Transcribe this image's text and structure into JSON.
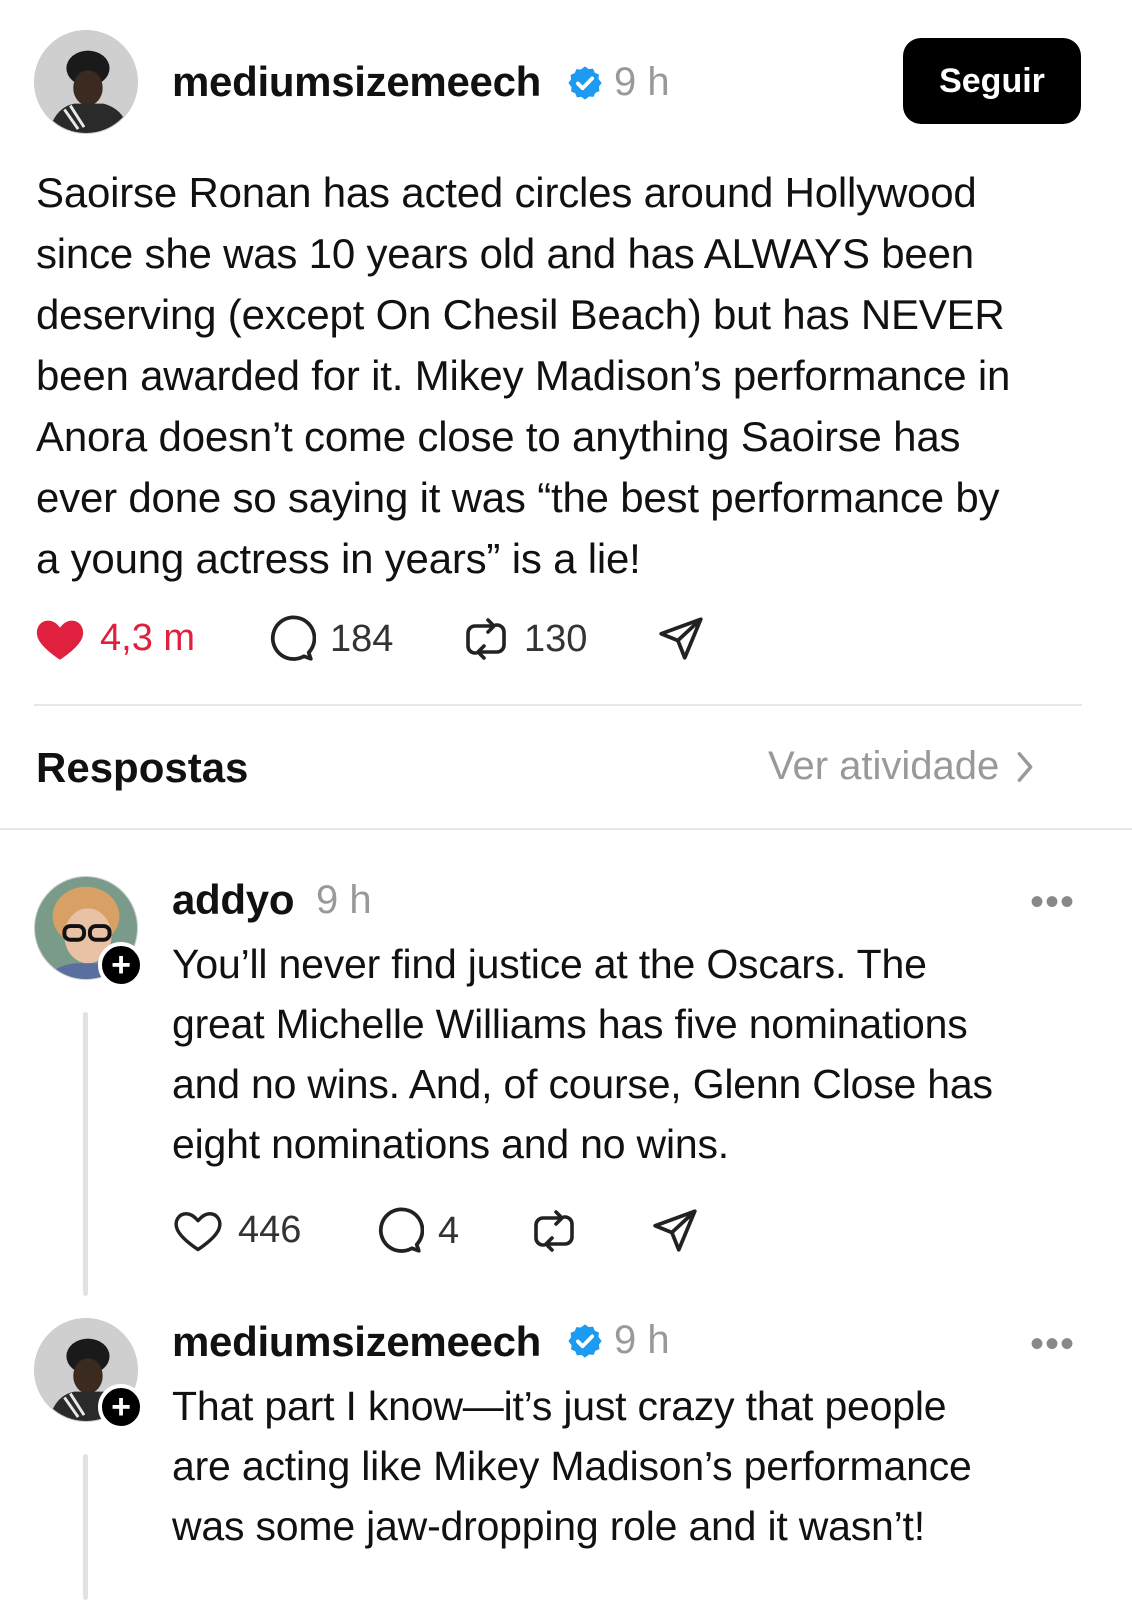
{
  "post": {
    "username": "mediumsizemeech",
    "time": "9 h",
    "follow_label": "Seguir",
    "text_lines": [
      "Saoirse Ronan has acted circles around Hollywood",
      "since she was 10 years old and has ALWAYS been",
      "deserving (except On Chesil Beach) but has NEVER",
      "been awarded for it. Mikey Madison’s performance in",
      "Anora doesn’t come close to anything Saoirse has",
      "ever done so saying it was “the best performance by",
      "a young actress in years” is a lie!"
    ],
    "likes": "4,3 m",
    "comments": "184",
    "reposts": "130"
  },
  "replies_header": {
    "title": "Respostas",
    "activity_label": "Ver atividade"
  },
  "reply1": {
    "username": "addyo",
    "time": "9 h",
    "more": "•••",
    "text_lines": [
      "You’ll never find justice at the Oscars. The",
      "great Michelle Williams has five nominations",
      "and no wins. And, of course, Glenn Close has",
      "eight nominations and no wins."
    ],
    "likes": "446",
    "comments": "4"
  },
  "reply2": {
    "username": "mediumsizemeech",
    "time": "9 h",
    "more": "•••",
    "text_lines": [
      "That part I know—it’s just crazy that people",
      "are acting like Mikey Madison’s performance",
      "was some jaw-dropping role and it wasn’t!"
    ]
  },
  "colors": {
    "like_active": "#e0203f",
    "verified": "#1d9bf0",
    "muted": "#999999"
  },
  "icons": [
    "heart-filled-icon",
    "heart-icon",
    "comment-icon",
    "repost-icon",
    "share-icon",
    "verified-icon",
    "chevron-right-icon",
    "plus-icon",
    "more-icon"
  ]
}
